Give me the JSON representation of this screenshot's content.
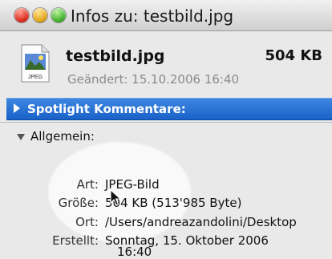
{
  "window": {
    "title": "Infos zu: testbild.jpg"
  },
  "file": {
    "name": "testbild.jpg",
    "size": "504 KB",
    "modified": "Geändert: 15.10.2006 16:40",
    "icon": "jpeg-file-icon",
    "icon_text": "JPEG"
  },
  "spotlight": {
    "label": "Spotlight Kommentare:"
  },
  "general": {
    "label": "Allgemein:",
    "rows": [
      {
        "label": "Art:",
        "value": "JPEG-Bild"
      },
      {
        "label": "Größe:",
        "value": "504 KB (513'985 Byte)"
      },
      {
        "label": "Ort:",
        "value": "/Users/andreazandolini/Desktop"
      },
      {
        "label": "Erstellt:",
        "value": "Sonntag, 15. Oktober 2006",
        "value2": "16:40"
      }
    ]
  }
}
